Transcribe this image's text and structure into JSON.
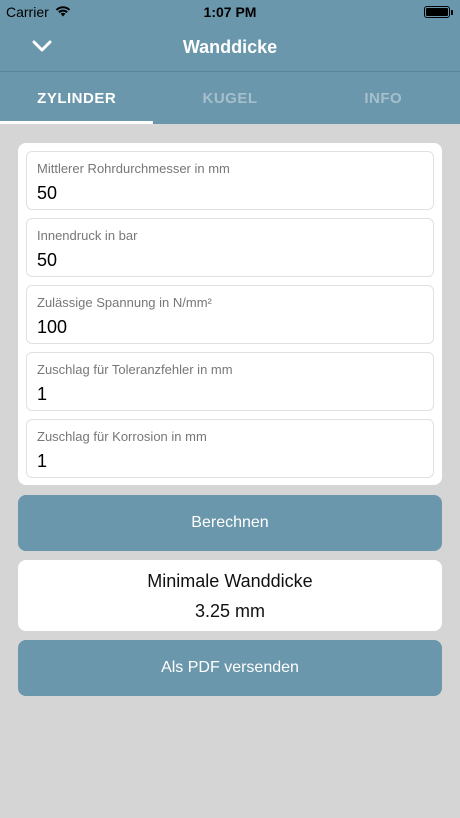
{
  "status_bar": {
    "carrier": "Carrier",
    "time": "1:07 PM"
  },
  "nav": {
    "title": "Wanddicke"
  },
  "tabs": [
    {
      "label": "ZYLINDER",
      "active": true
    },
    {
      "label": "KUGEL",
      "active": false
    },
    {
      "label": "INFO",
      "active": false
    }
  ],
  "form": {
    "fields": [
      {
        "label": "Mittlerer Rohrdurchmesser in mm",
        "value": "50"
      },
      {
        "label": "Innendruck in bar",
        "value": "50"
      },
      {
        "label": "Zulässige Spannung in N/mm²",
        "value": "100"
      },
      {
        "label": "Zuschlag für Toleranzfehler in mm",
        "value": "1"
      },
      {
        "label": "Zuschlag für Korrosion in mm",
        "value": "1"
      }
    ]
  },
  "actions": {
    "calculate_label": "Berechnen",
    "pdf_label": "Als PDF versenden"
  },
  "result": {
    "label": "Minimale Wanddicke",
    "value": "3.25 mm"
  },
  "colors": {
    "primary": "#6a97ab",
    "background": "#d5d5d5",
    "tab_inactive": "#a5c0cc"
  }
}
